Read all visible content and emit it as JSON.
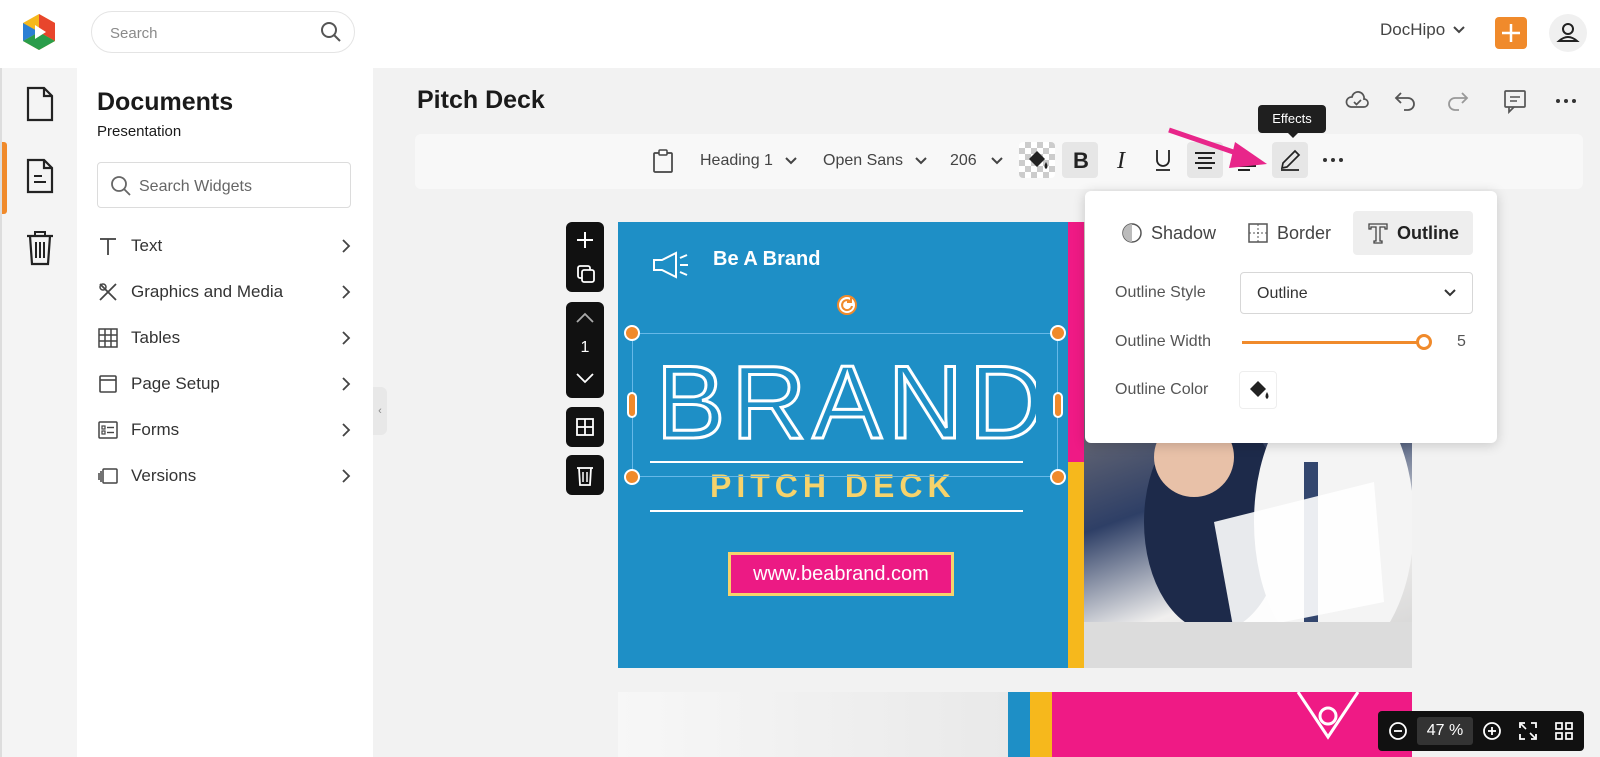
{
  "topbar": {
    "search_placeholder": "Search",
    "account_name": "DocHipo",
    "colors": {
      "accent": "#f08a2b"
    }
  },
  "panel": {
    "title": "Documents",
    "subtitle": "Presentation",
    "search_placeholder": "Search Widgets",
    "items": [
      {
        "label": "Text",
        "icon": "text-icon"
      },
      {
        "label": "Graphics and Media",
        "icon": "graphics-icon"
      },
      {
        "label": "Tables",
        "icon": "table-icon"
      },
      {
        "label": "Page Setup",
        "icon": "page-setup-icon"
      },
      {
        "label": "Forms",
        "icon": "forms-icon"
      },
      {
        "label": "Versions",
        "icon": "versions-icon"
      }
    ]
  },
  "editor": {
    "doc_title": "Pitch Deck",
    "toolbar": {
      "text_style": "Heading 1",
      "font": "Open Sans",
      "size": "206"
    },
    "tooltip": "Effects"
  },
  "slide": {
    "tagline": "Be A Brand",
    "big_word": "BRAND",
    "subtitle": "PITCH DECK",
    "url": "www.beabrand.com",
    "page_number": "1",
    "colors": {
      "background": "#1e8fc6",
      "pink": "#ef1a85",
      "yellow": "#f6b81c"
    }
  },
  "zoom": {
    "value": "47",
    "unit": "%"
  },
  "effects": {
    "tabs": [
      "Shadow",
      "Border",
      "Outline"
    ],
    "selected_tab": "Outline",
    "outline_style_label": "Outline Style",
    "outline_style_value": "Outline",
    "outline_width_label": "Outline Width",
    "outline_width_value": "5",
    "outline_color_label": "Outline Color"
  }
}
